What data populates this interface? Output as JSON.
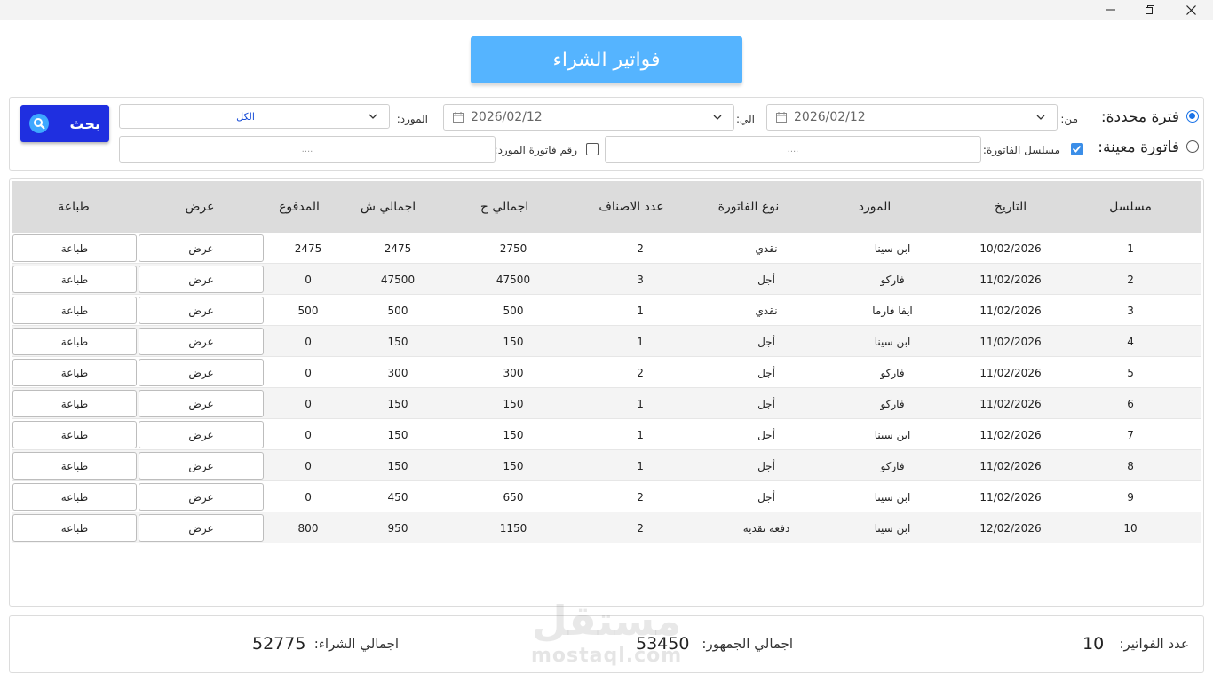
{
  "window": {
    "controls": [
      "minimize-icon",
      "maximize-icon",
      "close-icon"
    ]
  },
  "page_title": "فواتير الشراء",
  "filters": {
    "period_label": "فترة محددة:",
    "period_selected": true,
    "from_label": "من:",
    "from_date": "2026/02/12",
    "to_label": "الي:",
    "to_date": "2026/02/12",
    "supplier_label": "المورد:",
    "supplier_value": "الكل",
    "invoice_label": "فاتورة معينة:",
    "invoice_selected": false,
    "serial_label": "مسلسل الفاتورة:",
    "serial_checked": true,
    "serial_placeholder": "....",
    "supplier_invoice_label": "رقم فاتورة المورد:",
    "supplier_invoice_checked": false,
    "supplier_invoice_placeholder": "....",
    "search_label": "بحث"
  },
  "table": {
    "headers": {
      "serial": "مسلسل",
      "date": "التاريخ",
      "supplier": "المورد",
      "type": "نوع الفاتورة",
      "items": "عدد الاصناف",
      "total_public": "اجمالي ج",
      "total_purchase": "اجمالي ش",
      "paid": "المدفوع",
      "view": "عرض",
      "print": "طباعة"
    },
    "view_label": "عرض",
    "print_label": "طباعة",
    "rows": [
      {
        "serial": "1",
        "date": "10/02/2026",
        "supplier": "ابن سينا",
        "type": "نقدي",
        "items": "2",
        "total_public": "2750",
        "total_purchase": "2475",
        "paid": "2475"
      },
      {
        "serial": "2",
        "date": "11/02/2026",
        "supplier": "فاركو",
        "type": "أجل",
        "items": "3",
        "total_public": "47500",
        "total_purchase": "47500",
        "paid": "0"
      },
      {
        "serial": "3",
        "date": "11/02/2026",
        "supplier": "ايفا فارما",
        "type": "نقدي",
        "items": "1",
        "total_public": "500",
        "total_purchase": "500",
        "paid": "500"
      },
      {
        "serial": "4",
        "date": "11/02/2026",
        "supplier": "ابن سينا",
        "type": "أجل",
        "items": "1",
        "total_public": "150",
        "total_purchase": "150",
        "paid": "0"
      },
      {
        "serial": "5",
        "date": "11/02/2026",
        "supplier": "فاركو",
        "type": "أجل",
        "items": "2",
        "total_public": "300",
        "total_purchase": "300",
        "paid": "0"
      },
      {
        "serial": "6",
        "date": "11/02/2026",
        "supplier": "فاركو",
        "type": "أجل",
        "items": "1",
        "total_public": "150",
        "total_purchase": "150",
        "paid": "0"
      },
      {
        "serial": "7",
        "date": "11/02/2026",
        "supplier": "ابن سينا",
        "type": "أجل",
        "items": "1",
        "total_public": "150",
        "total_purchase": "150",
        "paid": "0"
      },
      {
        "serial": "8",
        "date": "11/02/2026",
        "supplier": "فاركو",
        "type": "أجل",
        "items": "1",
        "total_public": "150",
        "total_purchase": "150",
        "paid": "0"
      },
      {
        "serial": "9",
        "date": "11/02/2026",
        "supplier": "ابن سينا",
        "type": "أجل",
        "items": "2",
        "total_public": "650",
        "total_purchase": "450",
        "paid": "0"
      },
      {
        "serial": "10",
        "date": "12/02/2026",
        "supplier": "ابن سينا",
        "type": "دفعة نقدية",
        "items": "2",
        "total_public": "1150",
        "total_purchase": "950",
        "paid": "800"
      }
    ]
  },
  "summary": {
    "count_label": "عدد الفواتير:",
    "count_value": "10",
    "public_label": "اجمالي الجمهور:",
    "public_value": "53450",
    "purchase_label": "اجمالي الشراء:",
    "purchase_value": "52775"
  },
  "watermark": {
    "arabic": "مستقل",
    "latin": "mostaql.com"
  },
  "colors": {
    "title_bg": "#55b4ff",
    "search_bg": "#1f2fe0",
    "accent": "#1a73e8",
    "header_bg": "#dcdcdc"
  }
}
